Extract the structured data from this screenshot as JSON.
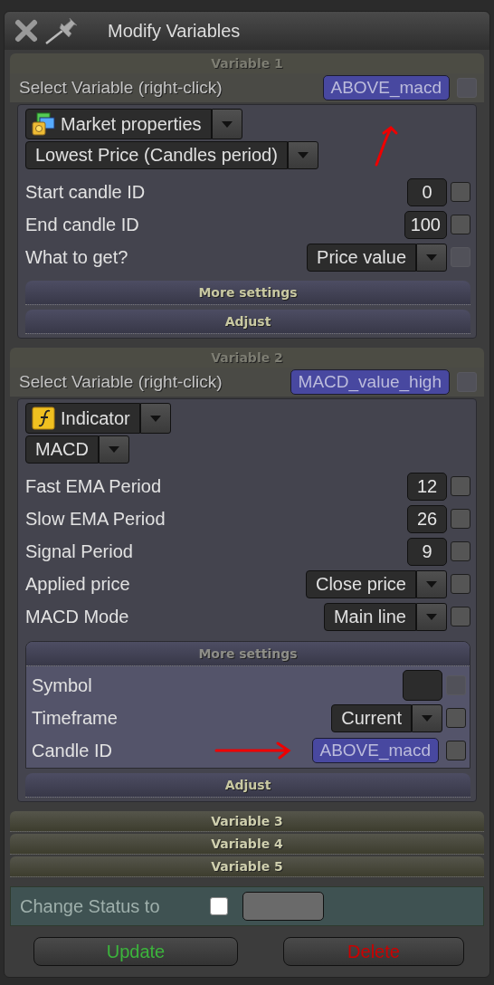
{
  "window": {
    "title": "Modify Variables"
  },
  "variables": [
    {
      "header": "Variable 1",
      "expanded": true,
      "select_label": "Select Variable (right-click)",
      "variable_name": "ABOVE_macd",
      "name_checkbox": {
        "checked": false,
        "disabled": true
      },
      "source": {
        "kind": "market",
        "label": "Market properties"
      },
      "function": "Lowest Price (Candles period)",
      "params": [
        {
          "kind": "number",
          "label": "Start candle ID",
          "value": "0",
          "checked": false,
          "disabled": false
        },
        {
          "kind": "number",
          "label": "End candle ID",
          "value": "100",
          "checked": false,
          "disabled": false
        },
        {
          "kind": "dropdown",
          "label": "What to get?",
          "value": "Price value",
          "checked": false,
          "disabled": true
        }
      ],
      "more_settings": {
        "label": "More settings",
        "expanded": false
      },
      "adjust": "Adjust"
    },
    {
      "header": "Variable 2",
      "expanded": true,
      "select_label": "Select Variable (right-click)",
      "variable_name": "MACD_value_high",
      "name_checkbox": {
        "checked": false,
        "disabled": true
      },
      "source": {
        "kind": "indicator",
        "label": "Indicator"
      },
      "function": "MACD",
      "params": [
        {
          "kind": "number",
          "label": "Fast EMA Period",
          "value": "12",
          "checked": false,
          "disabled": false
        },
        {
          "kind": "number",
          "label": "Slow EMA Period",
          "value": "26",
          "checked": false,
          "disabled": false
        },
        {
          "kind": "number",
          "label": "Signal Period",
          "value": "9",
          "checked": false,
          "disabled": false
        },
        {
          "kind": "dropdown",
          "label": "Applied price",
          "value": "Close price",
          "checked": false,
          "disabled": false
        },
        {
          "kind": "dropdown",
          "label": "MACD Mode",
          "value": "Main line",
          "checked": false,
          "disabled": false
        }
      ],
      "more_settings": {
        "label": "More settings",
        "expanded": true,
        "params": [
          {
            "kind": "text",
            "label": "Symbol",
            "checked": false,
            "disabled": true
          },
          {
            "kind": "dropdown",
            "label": "Timeframe",
            "value": "Current",
            "checked": false,
            "disabled": false
          },
          {
            "kind": "variable",
            "label": "Candle ID",
            "value": "ABOVE_macd",
            "checked": false,
            "disabled": false
          }
        ]
      },
      "adjust": "Adjust"
    },
    {
      "header": "Variable 3",
      "expanded": false
    },
    {
      "header": "Variable 4",
      "expanded": false
    },
    {
      "header": "Variable 5",
      "expanded": false
    }
  ],
  "status": {
    "label": "Change Status to",
    "checked": false
  },
  "buttons": [
    {
      "kind": "update",
      "label": "Update"
    },
    {
      "kind": "delete",
      "label": "Delete"
    }
  ]
}
